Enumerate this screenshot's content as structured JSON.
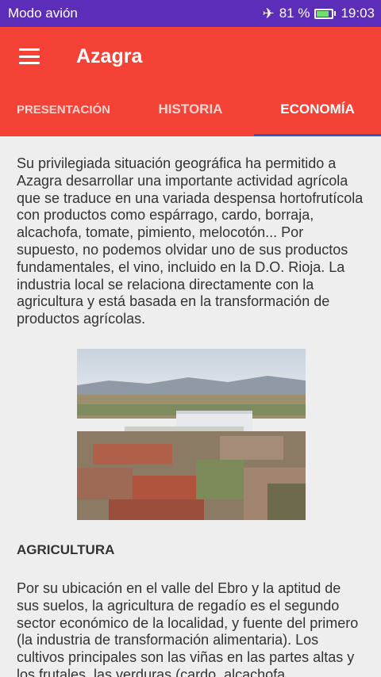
{
  "status_bar": {
    "mode": "Modo avión",
    "battery": "81 %",
    "battery_level": 0.81,
    "time": "19:03",
    "icons": [
      "airplane-icon",
      "battery-icon"
    ],
    "color": "#5B2DB8"
  },
  "app_bar": {
    "title": "Azagra",
    "color": "#F44336",
    "menu_icon": "hamburger-menu-icon"
  },
  "tabs": [
    {
      "label": "PRESENTACIÓN",
      "active": false
    },
    {
      "label": "HISTORIA",
      "active": false
    },
    {
      "label": "ECONOMÍA",
      "active": true
    }
  ],
  "content": {
    "intro": "Su privilegiada situación geográfica ha permitido a Azagra desarrollar una importante actividad agrícola que se traduce en una variada despensa hortofrutícola con productos como espárrago, cardo, borraja, alcachofa, tomate, pimiento, melocotón... Por supuesto, no podemos olvidar uno de sus productos fundamentales, el vino, incluido en la D.O. Rioja. La industria local se relaciona directamente con la agricultura y está basada en la transformación de productos agrícolas.",
    "photo": "town-aerial-photo",
    "section_heading": "AGRICULTURA",
    "section_text": "Por su ubicación en el valle del Ebro y la aptitud de sus suelos, la agricultura de regadío es el segundo sector económico de la localidad, y fuente del primero (la industria de transformación alimentaria). Los cultivos principales son las viñas en las partes altas y los frutales, las verduras (cardo, alcachofa,"
  }
}
